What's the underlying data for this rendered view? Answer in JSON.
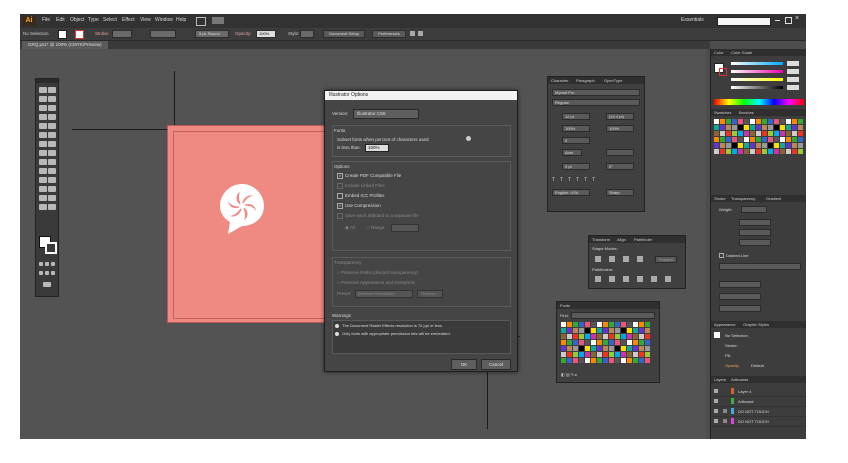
{
  "app": {
    "logo": "Ai"
  },
  "menu": [
    "File",
    "Edit",
    "Object",
    "Type",
    "Select",
    "Effect",
    "View",
    "Window",
    "Help"
  ],
  "workspace": {
    "label": "Essentials",
    "search_placeholder": ""
  },
  "control_bar": {
    "selection": "No Selection",
    "stroke_label": "Stroke:",
    "brush": "5 pt. Round",
    "opacity_label": "Opacity:",
    "opacity": "100%",
    "style_label": "Style:",
    "document_setup": "Document Setup",
    "preferences": "Preferences"
  },
  "document_tab": "GRQ.ps1* @ 100% (CMYK/Preview)",
  "dialog": {
    "title": "Illustrator Options",
    "version_label": "Version:",
    "version_value": "Illustrator CS6",
    "fonts_heading": "Fonts",
    "fonts_text_1": "Subset fonts when percent of characters used",
    "fonts_text_2": "is less than:",
    "fonts_value": "100%",
    "options_heading": "Options",
    "opt_pdf": "Create PDF Compatible File",
    "opt_linked": "Include Linked Files",
    "opt_icc": "Embed ICC Profiles",
    "opt_compression": "Use Compression",
    "opt_artboards": "Save each artboard to a separate file",
    "opt_all": "All",
    "opt_range": "Range:",
    "transparency_heading": "Transparency",
    "trans_1": "Preserve Paths (discard transparency)",
    "trans_2": "Preserve Appearance and Overprints",
    "trans_preset_label": "Preset:",
    "trans_preset_value": "[Medium Resolution]",
    "trans_custom": "Custom...",
    "warnings_heading": "Warnings",
    "warn_1": "The Document Raster Effects resolution is 72 ppi or less.",
    "warn_2": "Only fonts with appropriate permission bits will be embedded.",
    "ok": "OK",
    "cancel": "Cancel"
  },
  "character_panel": {
    "tabs": [
      "Character",
      "Paragraph",
      "OpenType"
    ],
    "font": "Myriad Pro",
    "style": "Regular",
    "size": "12 pt",
    "leading": "(14.4 pt)",
    "scale_h": "100%",
    "scale_v": "100%",
    "tracking": "0",
    "kerning": "Auto",
    "baseline": "0 pt",
    "rotation": "0°",
    "language": "English: USA",
    "aa": "Sharp"
  },
  "pathfinder_panel": {
    "tabs": [
      "Transform",
      "Align",
      "Pathfinder"
    ],
    "shape_modes": "Shape Modes:",
    "pathfinders": "Pathfinders:",
    "expand": "Expand"
  },
  "swatch_panel": {
    "title": "Fonts",
    "search": "Find:"
  },
  "color_panel": {
    "tabs": [
      "Color",
      "Color Guide"
    ]
  },
  "swatches_dock": {
    "tabs": [
      "Swatches",
      "Brushes"
    ]
  },
  "stroke_panel": {
    "tabs": [
      "Stroke",
      "Transparency",
      "Gradient"
    ],
    "weight_label": "Weight:",
    "dashed": "Dashed Line"
  },
  "appearance_panel": {
    "tabs": [
      "Appearance",
      "Graphic Styles"
    ],
    "no_selection": "No Selection",
    "stroke": "Stroke:",
    "fill": "Fill:",
    "opacity": "Opacity:",
    "opacity_value": "Default"
  },
  "layers_panel": {
    "tabs": [
      "Layers",
      "Artboards"
    ],
    "layers": [
      "Layer 4",
      "Artboard",
      "DO NOT TOUCH",
      "DO NOT TOUCH"
    ]
  },
  "colors": {
    "artboard": "#ef8a82",
    "dialog_bg": "#454545",
    "app_bg": "#4d4d4d"
  }
}
